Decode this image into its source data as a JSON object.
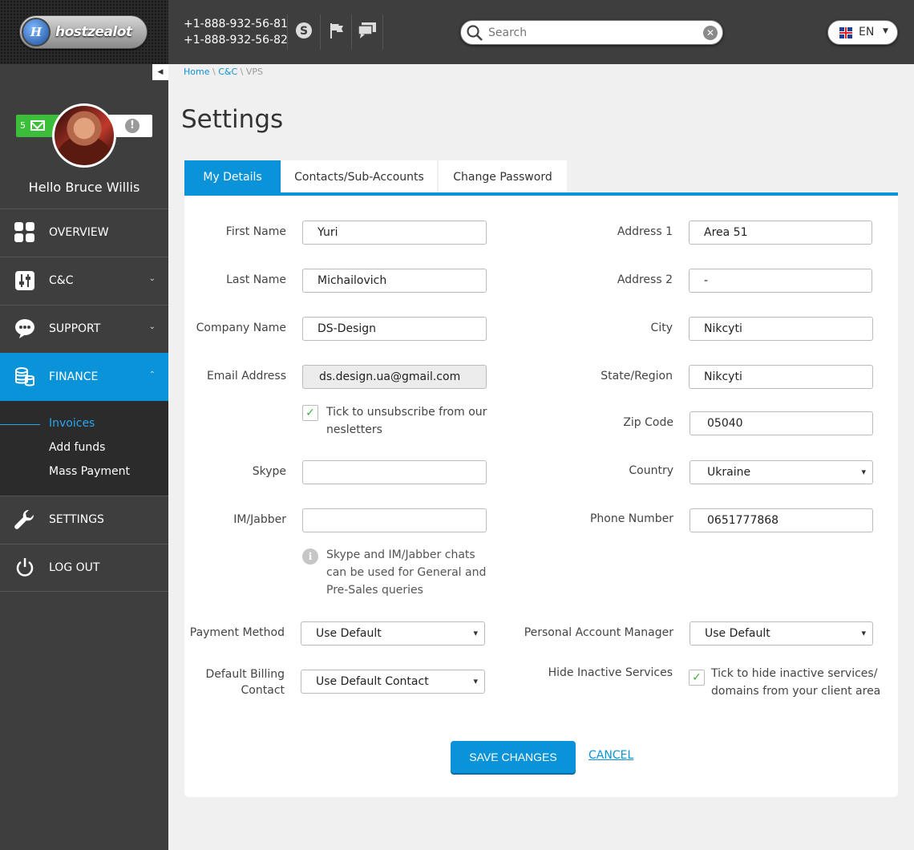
{
  "brand": {
    "name": "hostzealot"
  },
  "header": {
    "phones": [
      "+1-888-932-56-81",
      "+1-888-932-56-82"
    ],
    "search_placeholder": "Search",
    "language": "EN"
  },
  "user": {
    "greeting": "Hello",
    "name": "Bruce Willis",
    "unread_messages": "5"
  },
  "nav": [
    {
      "label": "OVERVIEW"
    },
    {
      "label": "C&C"
    },
    {
      "label": "SUPPORT"
    },
    {
      "label": "FINANCE"
    },
    {
      "label": "SETTINGS"
    },
    {
      "label": "LOG OUT"
    }
  ],
  "finance_sub": [
    "Invoices",
    "Add funds",
    "Mass Payment"
  ],
  "breadcrumb": {
    "home": "Home",
    "cc": "C&C",
    "current": "VPS",
    "sep": "\\"
  },
  "page_title": "Settings",
  "tabs": [
    "My Details",
    "Contacts/Sub-Accounts",
    "Change Password"
  ],
  "form": {
    "first_name": {
      "label": "First Name",
      "value": "Yuri"
    },
    "last_name": {
      "label": "Last Name",
      "value": "Michailovich"
    },
    "company": {
      "label": "Company Name",
      "value": "DS-Design"
    },
    "email": {
      "label": "Email Address",
      "value": "ds.design.ua@gmail.com"
    },
    "unsubscribe": {
      "line1": "Tick to unsubscribe from our",
      "line2": "nesletters"
    },
    "skype": {
      "label": "Skype",
      "value": ""
    },
    "im": {
      "label": "IM/Jabber",
      "value": ""
    },
    "info": {
      "line1": "Skype and IM/Jabber chats",
      "line2": "can be used for General and",
      "line3": "Pre-Sales queries"
    },
    "payment": {
      "label": "Payment Method",
      "value": "Use Default"
    },
    "billing": {
      "label1": "Default Billing",
      "label2": "Contact",
      "value": "Use Default Contact"
    },
    "address1": {
      "label": "Address 1",
      "value": "Area 51"
    },
    "address2": {
      "label": "Address 2",
      "value": "-"
    },
    "city": {
      "label": "City",
      "value": "Nikcyti"
    },
    "state": {
      "label": "State/Region",
      "value": "Nikcyti"
    },
    "zip": {
      "label": "Zip Code",
      "value": "05040"
    },
    "country": {
      "label": "Country",
      "value": "Ukraine"
    },
    "phone": {
      "label": "Phone Number",
      "value": "0651777868"
    },
    "manager": {
      "label": "Personal Account Manager",
      "value": "Use Default"
    },
    "hide_inactive": {
      "label": "Hide Inactive Services",
      "line1": "Tick to hide inactive services/",
      "line2": "domains from your client area"
    }
  },
  "actions": {
    "save": "SAVE CHANGES",
    "cancel": "CANCEL"
  }
}
